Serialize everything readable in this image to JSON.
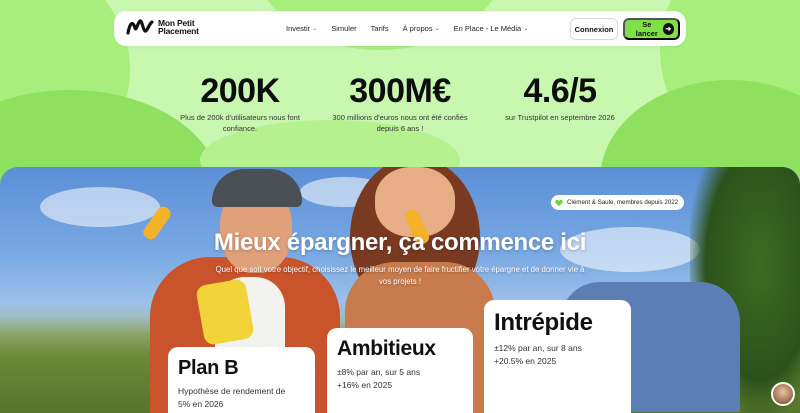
{
  "brand": {
    "name_line1": "Mon Petit",
    "name_line2": "Placement"
  },
  "nav": {
    "links": [
      {
        "label": "Investir",
        "has_dropdown": true
      },
      {
        "label": "Simuler",
        "has_dropdown": false
      },
      {
        "label": "Tarifs",
        "has_dropdown": false
      },
      {
        "label": "À propos",
        "has_dropdown": true
      },
      {
        "label": "En Place - Le Média",
        "has_dropdown": true
      }
    ],
    "login_label": "Connexion",
    "cta_label": "Se lancer",
    "cta_color": "#7fe048"
  },
  "stats": [
    {
      "value": "200K",
      "desc": "Plus de 200k d'utilisateurs nous font confiance."
    },
    {
      "value": "300M€",
      "desc": "300 millions d'euros nous ont été confiés depuis 6 ans !"
    },
    {
      "value": "4.6/5",
      "desc": "sur Trustpilot en septembre 2026"
    }
  ],
  "hero": {
    "testimonial": "Clément & Saule, membres depuis 2022",
    "title": "Mieux épargner, ça commence ici",
    "subtitle": "Quel que soit votre objectif, choisissez le meilleur moyen de faire fructifier votre épargne et de donner vie à vos projets !"
  },
  "cards": [
    {
      "title": "Plan B",
      "line1": "Hypothèse de rendement de",
      "line2": "5% en 2026"
    },
    {
      "title": "Ambitieux",
      "line1": "±8% par an, sur 5 ans",
      "line2": "+16% en 2025"
    },
    {
      "title": "Intrépide",
      "line1": "±12% par an, sur 8 ans",
      "line2": "+20.5% en 2025"
    }
  ],
  "colors": {
    "background": "#c8f7b0",
    "accent": "#7fe048"
  }
}
